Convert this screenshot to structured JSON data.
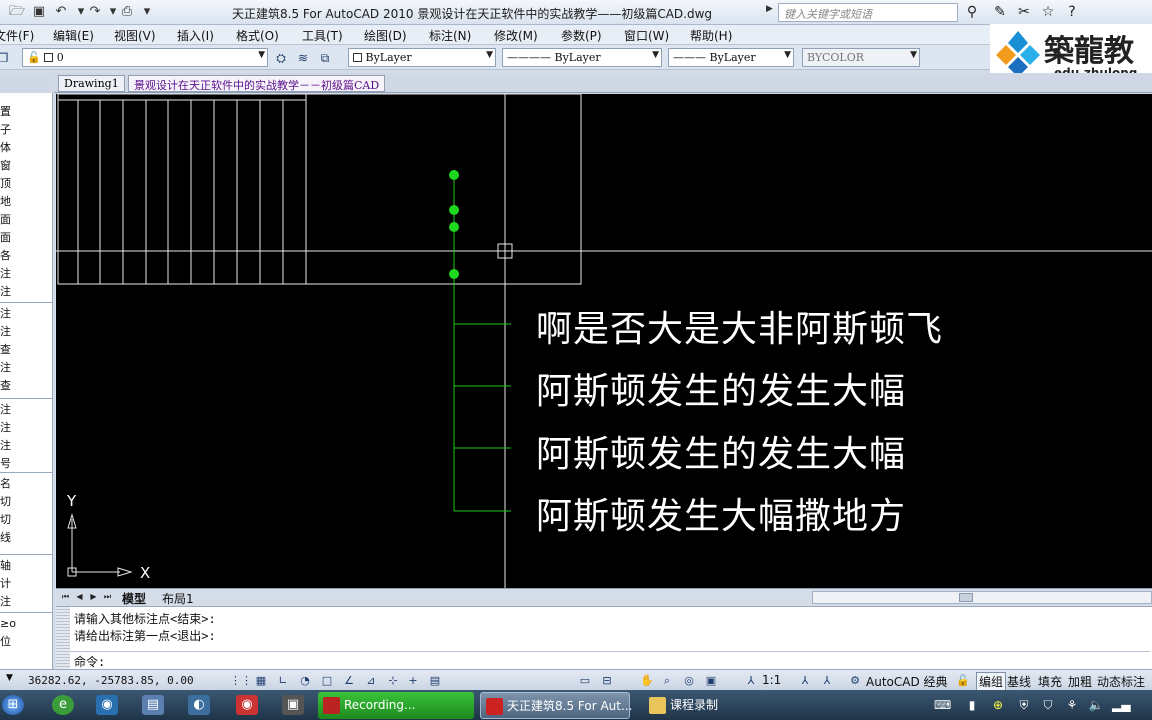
{
  "window": {
    "title": "天正建筑8.5 For AutoCAD 2010     景观设计在天正软件中的实战教学——初级篇CAD.dwg",
    "search_placeholder": "键入关键字或短语"
  },
  "menu": [
    "文件(F)",
    "编辑(E)",
    "视图(V)",
    "插入(I)",
    "格式(O)",
    "工具(T)",
    "绘图(D)",
    "标注(N)",
    "修改(M)",
    "参数(P)",
    "窗口(W)",
    "帮助(H)"
  ],
  "toolbar": {
    "layer_value": "0",
    "color_value": "ByLayer",
    "linetype_value": "———— ByLayer",
    "lineweight_value": "——— ByLayer",
    "plotstyle_value": "BYCOLOR"
  },
  "logo": {
    "name": "築龍教",
    "url": "edu.zhulong."
  },
  "palette": {
    "group1": [
      "置",
      "子",
      "体",
      "窗",
      "顶",
      "地",
      "面",
      "面",
      "各",
      "注",
      "注"
    ],
    "group2": [
      "注",
      "注",
      "查",
      "注",
      "查"
    ],
    "group3": [
      "注",
      "注",
      "注",
      "号"
    ],
    "group4": [
      "名",
      "切",
      "切",
      "线"
    ],
    "group5": [
      "轴",
      "计",
      "注"
    ],
    "group6": [
      "≥o",
      "位"
    ]
  },
  "doc_tabs": [
    "Drawing1",
    "景观设计在天正软件中的实战教学－－初级篇CAD"
  ],
  "canvas": {
    "annotations": [
      "啊是否大是大非阿斯顿飞",
      "阿斯顿发生的发生大幅",
      "阿斯顿发生的发生大幅",
      "阿斯顿发生大幅撒地方"
    ],
    "axis_x": "X",
    "axis_y": "Y",
    "grip_color": "#1ed81e",
    "leader_color": "#1ec81e"
  },
  "layout_tabs": [
    "模型",
    "布局1"
  ],
  "command": {
    "history": [
      "请输入其他标注点<结束>:",
      "请给出标注第一点<退出>:"
    ],
    "prompt": "命令:"
  },
  "status": {
    "coords": "36282.62, -25783.85, 0.00",
    "scale": "1:1",
    "workspace": "AutoCAD 经典",
    "buttons": [
      "编组",
      "基线",
      "填充",
      "加粗",
      "动态标注"
    ]
  },
  "taskbar": {
    "items": [
      "Recording...",
      "天正建筑8.5 For Aut...",
      "课程录制"
    ]
  }
}
